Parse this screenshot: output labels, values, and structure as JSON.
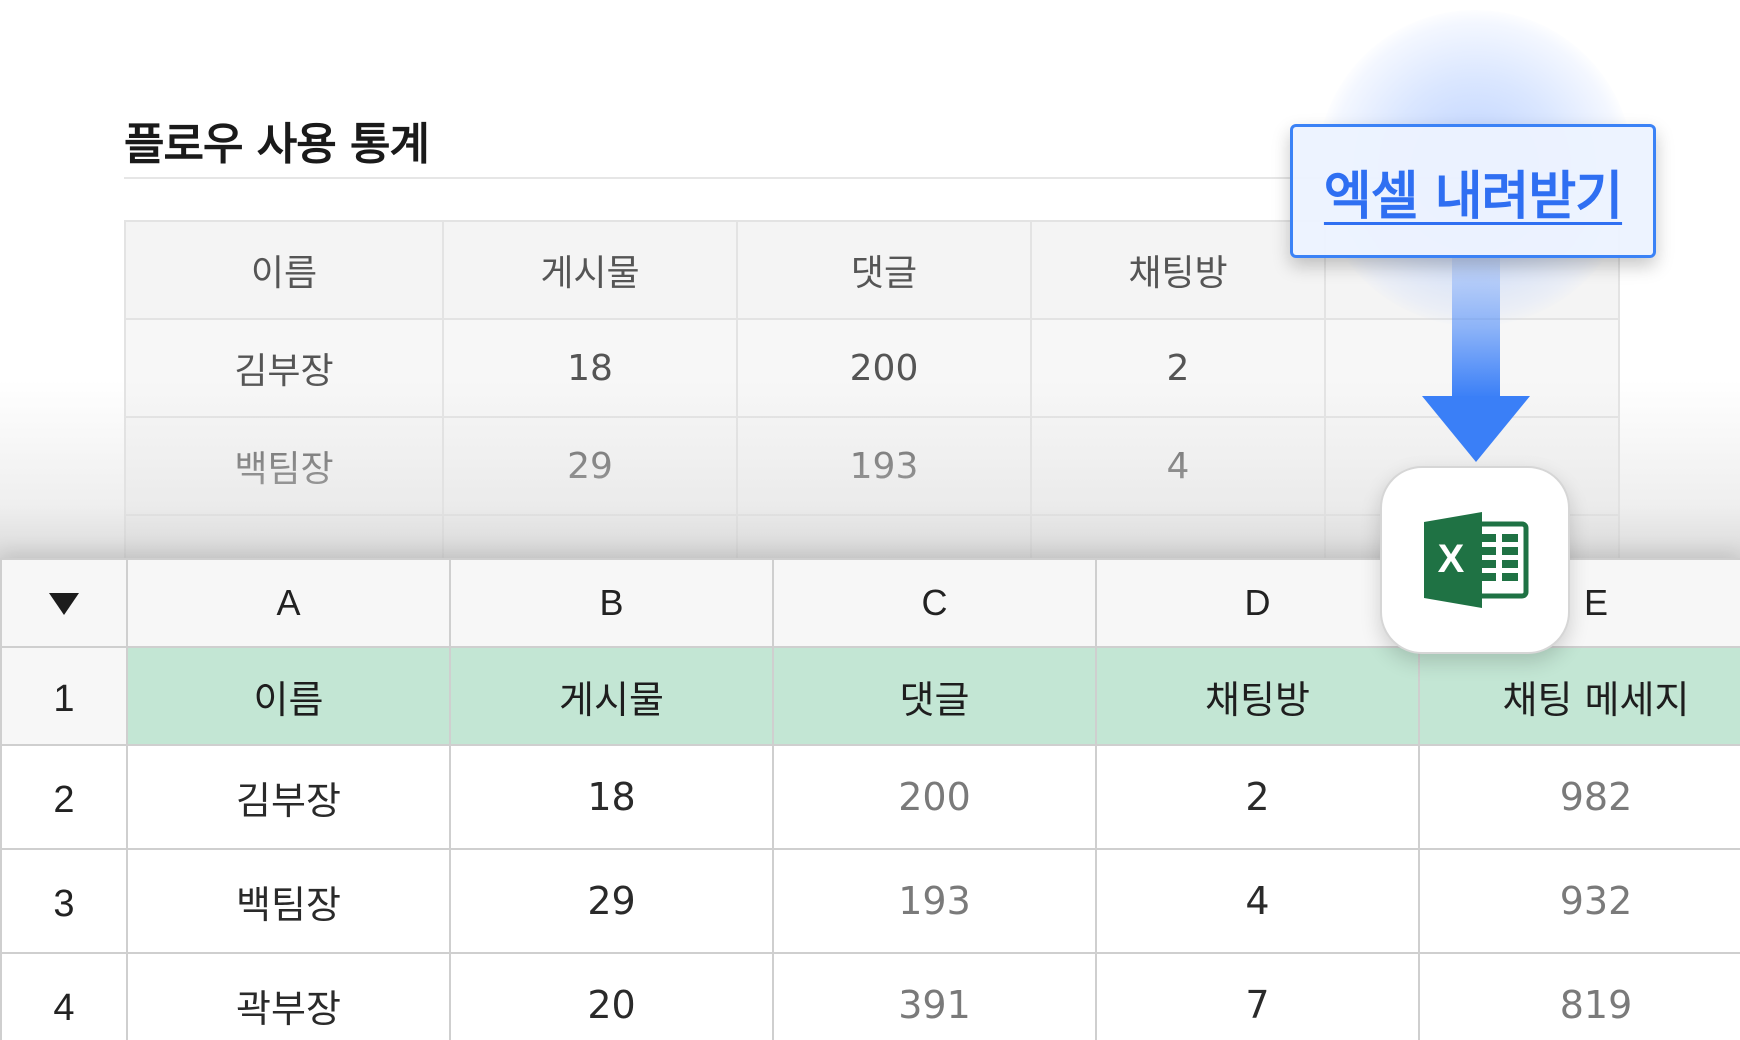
{
  "stats_panel": {
    "title": "플로우 사용 통계",
    "headers": [
      "이름",
      "게시물",
      "댓글",
      "채팅방"
    ],
    "rows": [
      [
        "김부장",
        "18",
        "200",
        "2"
      ],
      [
        "백팀장",
        "29",
        "193",
        "4"
      ]
    ]
  },
  "download": {
    "label": "엑셀 내려받기",
    "icon": "excel-icon",
    "accent_color": "#3b82f6"
  },
  "spreadsheet": {
    "columns": [
      "A",
      "B",
      "C",
      "D",
      "E"
    ],
    "row_numbers": [
      "1",
      "2",
      "3",
      "4"
    ],
    "header": [
      "이름",
      "게시물",
      "댓글",
      "채팅방",
      "채팅 메세지"
    ],
    "rows": [
      [
        "김부장",
        "18",
        "200",
        "2",
        "982"
      ],
      [
        "백팀장",
        "29",
        "193",
        "4",
        "932"
      ],
      [
        "곽부장",
        "20",
        "391",
        "7",
        "819"
      ]
    ],
    "header_fill_color": "#c3e6d4",
    "excel_green": "#1f7244"
  }
}
